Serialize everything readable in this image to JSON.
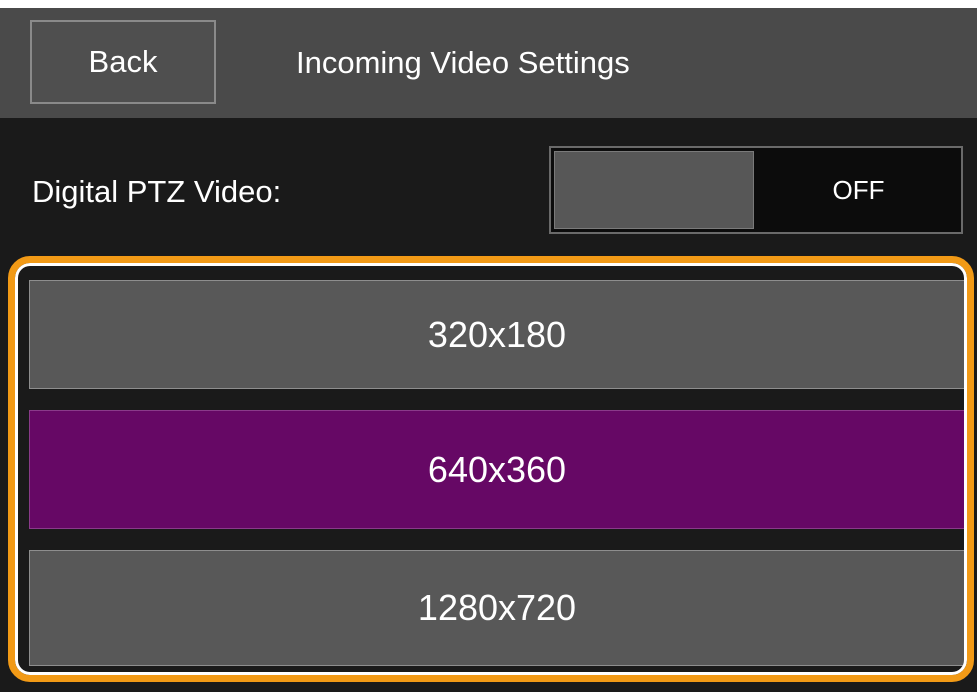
{
  "header": {
    "back_label": "Back",
    "title": "Incoming Video Settings"
  },
  "ptz": {
    "label": "Digital PTZ Video:",
    "toggle_state": "OFF"
  },
  "resolutions": [
    {
      "label": "320x180",
      "selected": false
    },
    {
      "label": "640x360",
      "selected": true
    },
    {
      "label": "1280x720",
      "selected": false
    }
  ],
  "colors": {
    "header_bg": "#4a4a4a",
    "screen_bg": "#1a1a1a",
    "option_bg": "#585858",
    "selected_bg": "#660865",
    "highlight_frame": "#f29a16"
  }
}
